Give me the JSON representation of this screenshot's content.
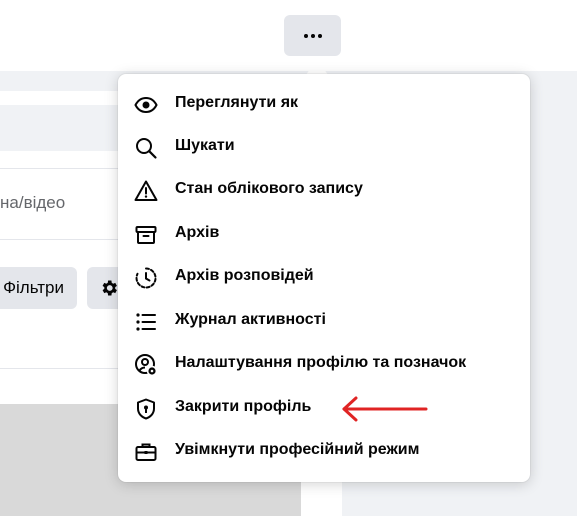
{
  "topbar": {
    "more_icon": "more-dots-icon"
  },
  "background_panel": {
    "search_text": "на/відео",
    "filters_label": "Фільтри",
    "settings_icon": "gear-icon"
  },
  "menu": {
    "items": [
      {
        "label": "Переглянути як",
        "icon": "eye-icon"
      },
      {
        "label": "Шукати",
        "icon": "search-icon"
      },
      {
        "label": "Стан облікового запису",
        "icon": "warning-icon"
      },
      {
        "label": "Архів",
        "icon": "archive-icon"
      },
      {
        "label": "Архів розповідей",
        "icon": "story-archive-icon"
      },
      {
        "label": "Журнал активності",
        "icon": "list-icon"
      },
      {
        "label": "Налаштування профілю та позначок",
        "icon": "profile-settings-icon"
      },
      {
        "label": "Закрити профіль",
        "icon": "shield-lock-icon"
      },
      {
        "label": "Увімкнути професійний режим",
        "icon": "briefcase-icon"
      }
    ]
  },
  "annotation": {
    "color": "#e02424"
  }
}
